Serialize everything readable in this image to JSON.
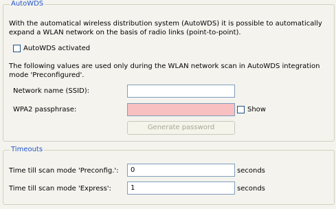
{
  "autowds": {
    "title": "AutoWDS",
    "description_line1": "With the automatical wireless distribution system (AutoWDS) it is possible to automatically",
    "description_line2": "expand a WLAN network on the basis of radio links (point-to-point).",
    "activated_label": "AutoWDS activated",
    "activated_checked": false,
    "note_line1": "The following values are used only during the WLAN network scan in AutoWDS integration",
    "note_line2": "mode 'Preconfigured'.",
    "ssid_label": "Network name (SSID):",
    "ssid_value": "",
    "passphrase_label": "WPA2 passphrase:",
    "passphrase_value": "",
    "show_label": "Show",
    "show_checked": false,
    "generate_button_label": "Generate password",
    "generate_button_enabled": false
  },
  "timeouts": {
    "title": "Timeouts",
    "preconfig_label": "Time till scan mode 'Preconfig.':",
    "preconfig_value": "0",
    "preconfig_unit": "seconds",
    "express_label": "Time till scan mode 'Express':",
    "express_value": "1",
    "express_unit": "seconds"
  },
  "colors": {
    "group_title": "#1f54c7",
    "invalid_field": "#f8c0c0",
    "panel_background": "#f4f3ee"
  }
}
